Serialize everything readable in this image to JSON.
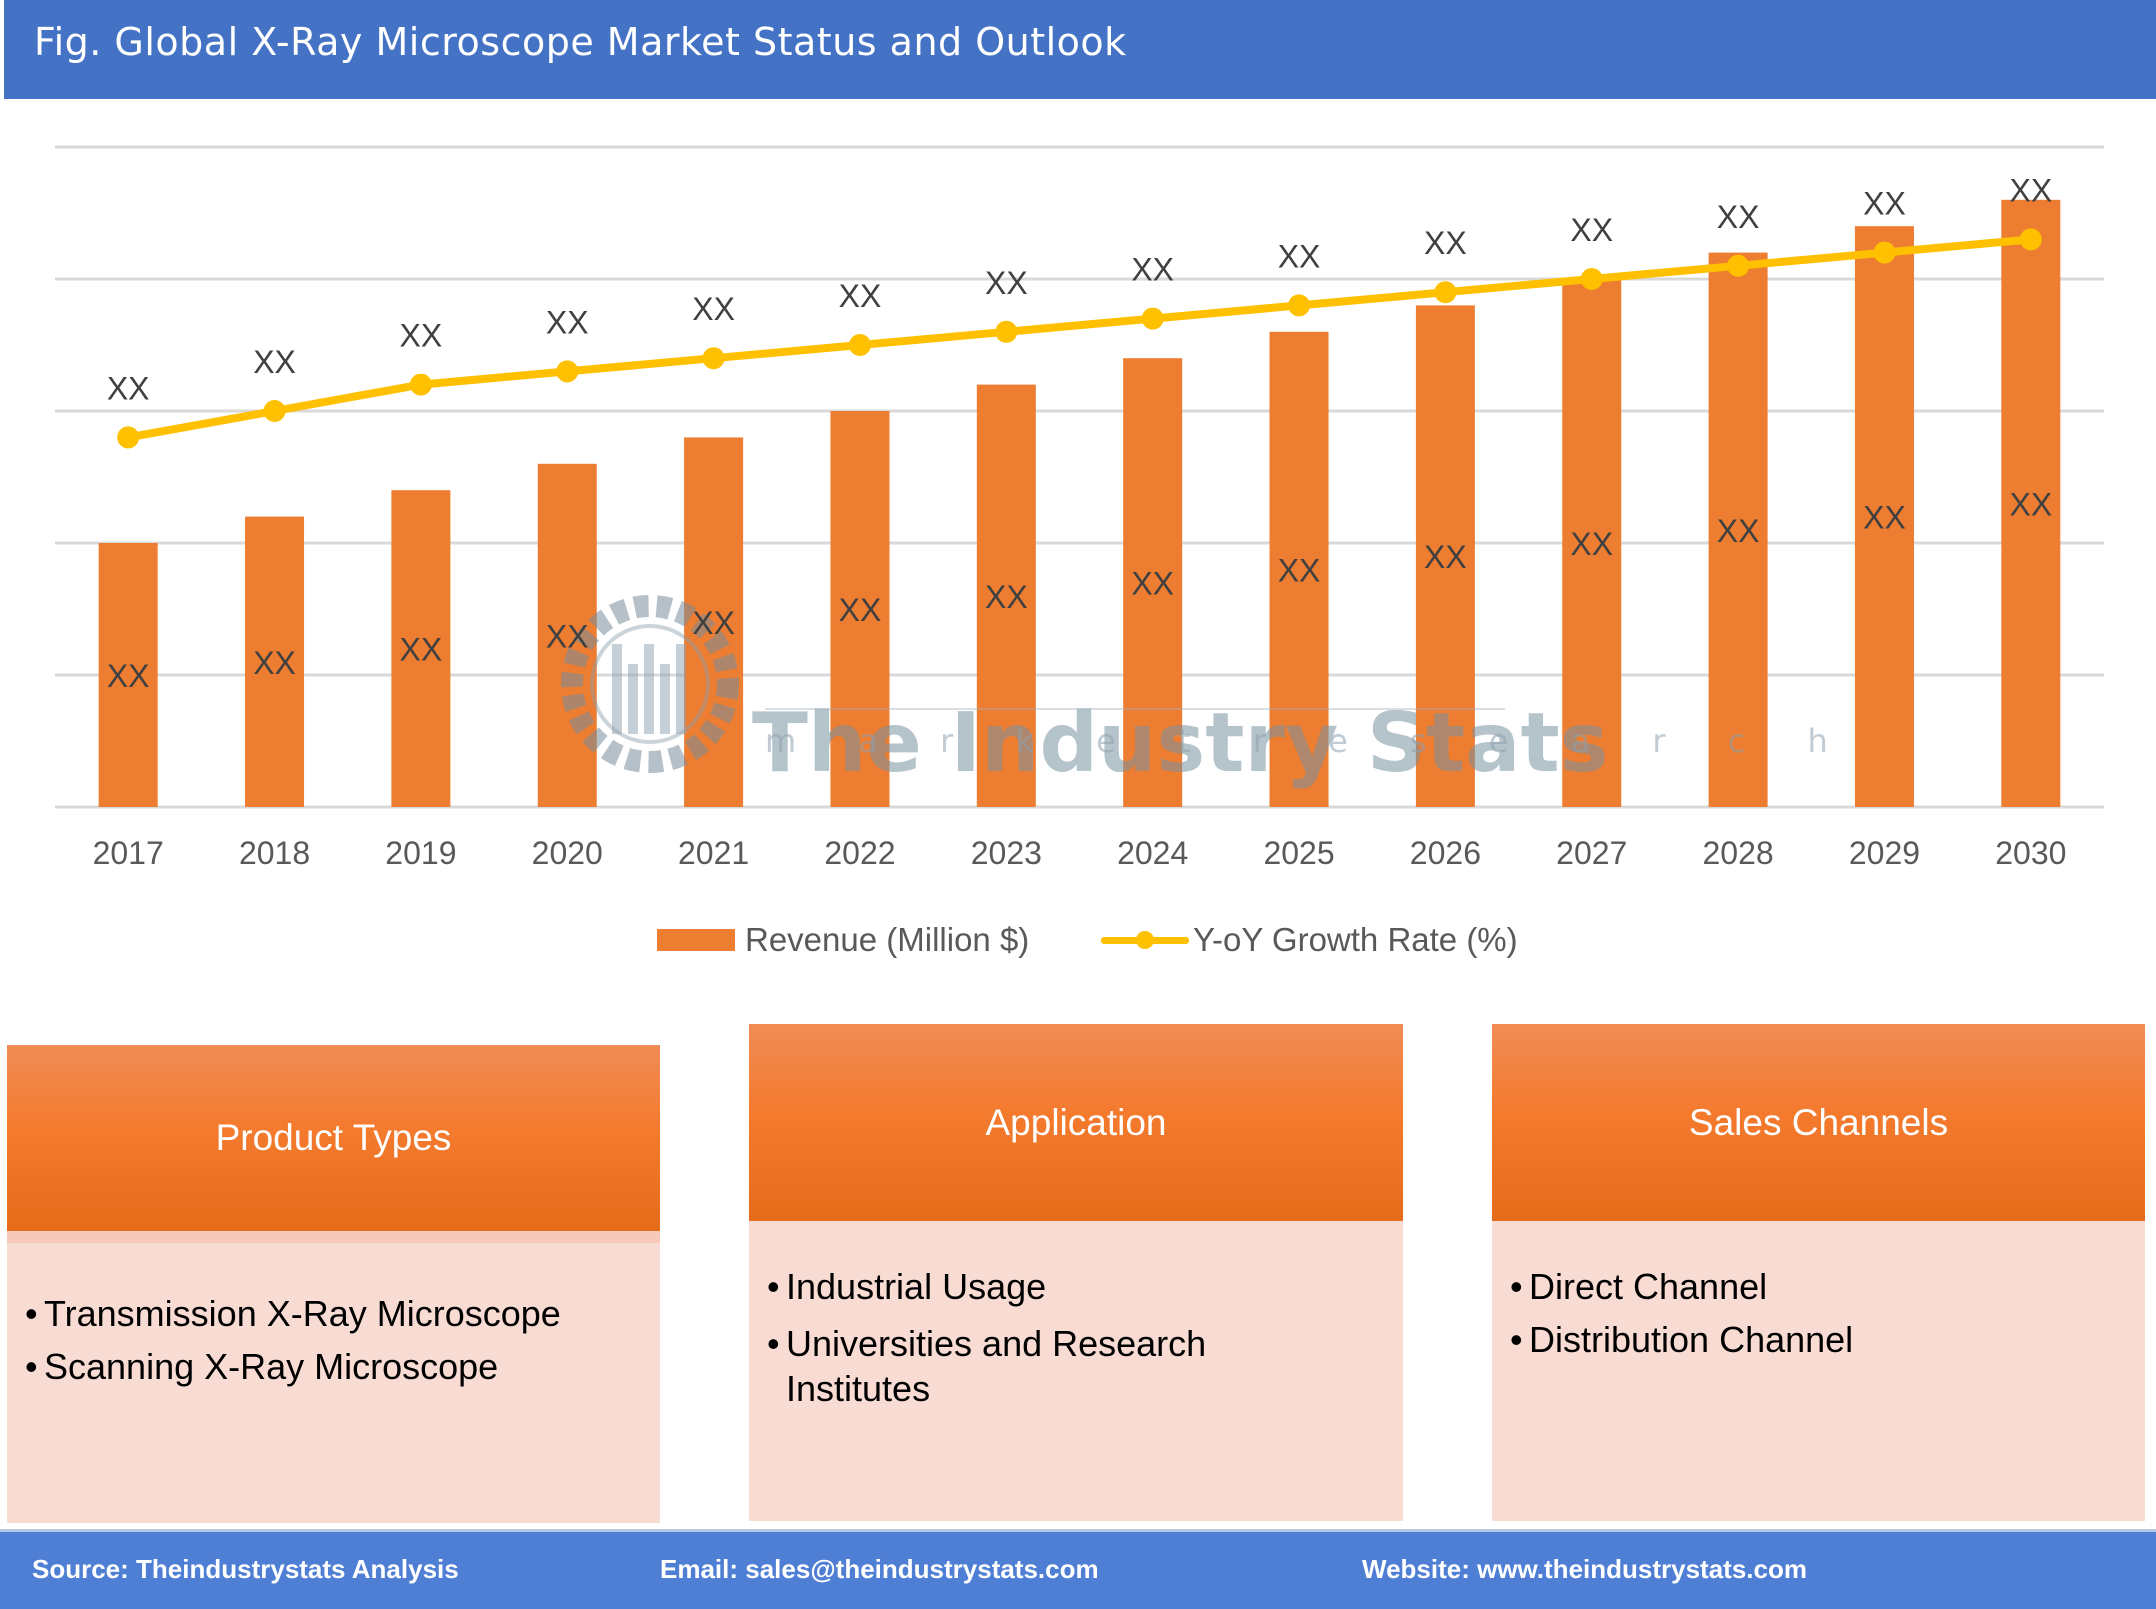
{
  "header": {
    "title": "Fig. Global X-Ray Microscope Market Status and Outlook"
  },
  "watermark": {
    "name": "The Industry Stats",
    "tagline": "m a r k e t   r e s e a r c h"
  },
  "chart_data": {
    "type": "bar+line",
    "title": "Fig. Global X-Ray Microscope Market Status and Outlook",
    "categories": [
      "2017",
      "2018",
      "2019",
      "2020",
      "2021",
      "2022",
      "2023",
      "2024",
      "2025",
      "2026",
      "2027",
      "2028",
      "2029",
      "2030"
    ],
    "series": [
      {
        "name": "Revenue (Million $)",
        "type": "bar",
        "color": "#ed7d31",
        "values": [
          40,
          44,
          48,
          52,
          56,
          60,
          64,
          68,
          72,
          76,
          80,
          84,
          88,
          92
        ],
        "labels": [
          "XX",
          "XX",
          "XX",
          "XX",
          "XX",
          "XX",
          "XX",
          "XX",
          "XX",
          "XX",
          "XX",
          "XX",
          "XX",
          "XX"
        ]
      },
      {
        "name": "Y-oY Growth Rate (%)",
        "type": "line",
        "color": "#ffc000",
        "values": [
          56,
          60,
          64,
          66,
          68,
          70,
          72,
          74,
          76,
          78,
          80,
          82,
          84,
          86
        ],
        "labels": [
          "XX",
          "XX",
          "XX",
          "XX",
          "XX",
          "XX",
          "XX",
          "XX",
          "XX",
          "XX",
          "XX",
          "XX",
          "XX",
          "XX"
        ]
      }
    ],
    "ylim": [
      0,
      100
    ],
    "gridlines": 5,
    "grid": true,
    "axis_values_hidden": true,
    "legend": "bottom",
    "xlabel": "",
    "ylabel": ""
  },
  "segments": [
    {
      "title": "Product Types",
      "items": [
        "Transmission X-Ray Microscope",
        "Scanning X-Ray Microscope"
      ]
    },
    {
      "title": "Application",
      "items": [
        "Industrial Usage",
        "Universities and Research Institutes"
      ]
    },
    {
      "title": "Sales Channels",
      "items": [
        "Direct Channel",
        "Distribution Channel"
      ]
    }
  ],
  "footer": {
    "source": "Source: Theindustrystats Analysis",
    "email": "Email: sales@theindustrystats.com",
    "website": "Website: www.theindustrystats.com"
  }
}
